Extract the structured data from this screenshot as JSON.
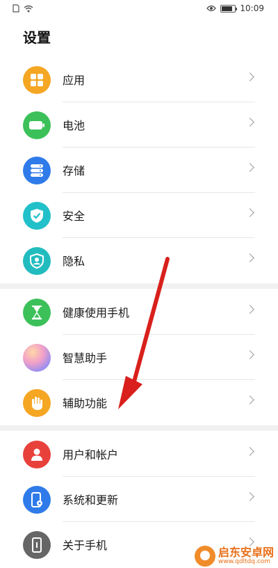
{
  "status_bar": {
    "time": "10:09"
  },
  "page_title": "设置",
  "groups": [
    {
      "items": [
        {
          "label": "应用",
          "icon": "apps-grid-icon",
          "color": "#f5a623"
        },
        {
          "label": "电池",
          "icon": "battery-icon",
          "color": "#3cc15a"
        },
        {
          "label": "存储",
          "icon": "storage-icon",
          "color": "#2f7be9"
        },
        {
          "label": "安全",
          "icon": "shield-check-icon",
          "color": "#22c0c9"
        },
        {
          "label": "隐私",
          "icon": "privacy-icon",
          "color": "#22bcbf"
        }
      ]
    },
    {
      "items": [
        {
          "label": "健康使用手机",
          "icon": "hourglass-icon",
          "color": "#3cc15a"
        },
        {
          "label": "智慧助手",
          "icon": "assistant-orb-icon",
          "color": "#c6a3f0"
        },
        {
          "label": "辅助功能",
          "icon": "hand-icon",
          "color": "#f5a623"
        }
      ]
    },
    {
      "items": [
        {
          "label": "用户和帐户",
          "icon": "user-icon",
          "color": "#e8413c"
        },
        {
          "label": "系统和更新",
          "icon": "system-update-icon",
          "color": "#2f7be9"
        },
        {
          "label": "关于手机",
          "icon": "phone-info-icon",
          "color": "#666666"
        }
      ]
    }
  ],
  "annotation": {
    "color": "#d9201c"
  },
  "watermark": {
    "title": "启东安卓网",
    "url": "www.qdltdq.com"
  }
}
